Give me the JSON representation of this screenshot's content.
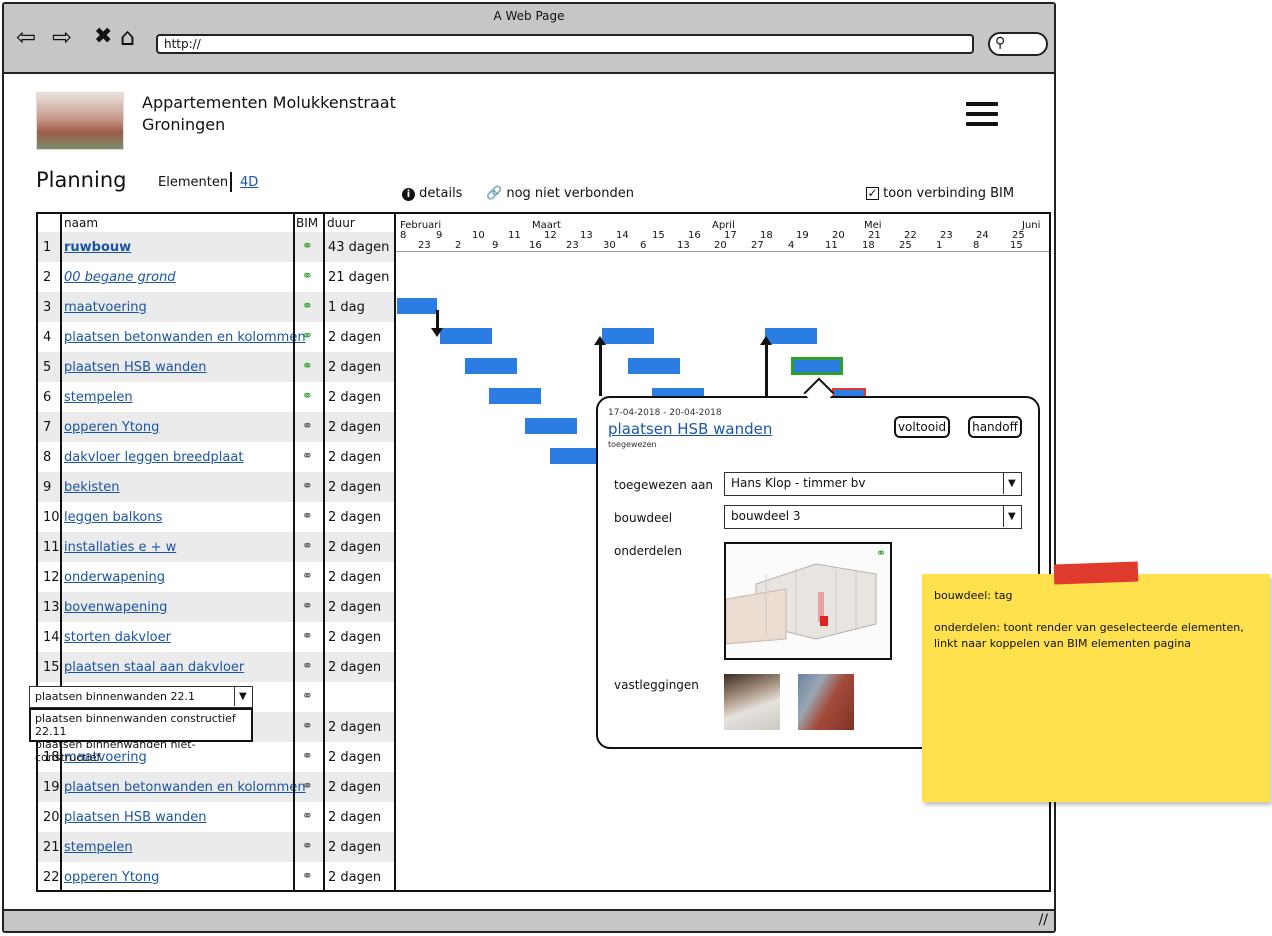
{
  "window": {
    "title": "A Web Page",
    "url": "http://"
  },
  "project": {
    "name_line1": "Appartementen Molukkenstraat",
    "name_line2": "Groningen"
  },
  "page": {
    "title": "Planning",
    "tab_elements": "Elementen",
    "tab_4d": "4D"
  },
  "toolbar": {
    "details": "details",
    "not_linked": "nog niet verbonden",
    "show_bim": "toon verbinding BIM",
    "show_bim_checked": true
  },
  "table": {
    "headers": {
      "name": "naam",
      "bim": "BIM",
      "duration": "duur"
    },
    "rows": [
      {
        "n": "1",
        "name": "ruwbouw",
        "dur": "43 dagen",
        "linked": true,
        "style": "bold"
      },
      {
        "n": "2",
        "name": "00 begane grond",
        "dur": "21 dagen",
        "linked": true,
        "style": "italic"
      },
      {
        "n": "3",
        "name": "maatvoering",
        "dur": "1 dag",
        "linked": true
      },
      {
        "n": "4",
        "name": "plaatsen betonwanden en kolommen",
        "dur": "2 dagen",
        "linked": true
      },
      {
        "n": "5",
        "name": "plaatsen HSB wanden",
        "dur": "2 dagen",
        "linked": true
      },
      {
        "n": "6",
        "name": "stempelen",
        "dur": "2 dagen",
        "linked": true
      },
      {
        "n": "7",
        "name": "opperen Ytong",
        "dur": "2 dagen",
        "linked": false
      },
      {
        "n": "8",
        "name": "dakvloer leggen breedplaat",
        "dur": "2 dagen",
        "linked": false
      },
      {
        "n": "9",
        "name": "bekisten",
        "dur": "2 dagen",
        "linked": false
      },
      {
        "n": "10",
        "name": "leggen balkons",
        "dur": "2 dagen",
        "linked": false
      },
      {
        "n": "11",
        "name": "installaties e + w",
        "dur": "2 dagen",
        "linked": false
      },
      {
        "n": "12",
        "name": "onderwapening",
        "dur": "2 dagen",
        "linked": false
      },
      {
        "n": "13",
        "name": "bovenwapening",
        "dur": "2 dagen",
        "linked": false
      },
      {
        "n": "14",
        "name": "storten dakvloer",
        "dur": "2 dagen",
        "linked": false
      },
      {
        "n": "15",
        "name": "plaatsen staal aan dakvloer",
        "dur": "2 dagen",
        "linked": false
      },
      {
        "n": "16",
        "name": "",
        "dur": "",
        "linked": false
      },
      {
        "n": "17",
        "name": "",
        "dur": "2 dagen",
        "linked": false
      },
      {
        "n": "18",
        "name": "maatvoering",
        "dur": "2 dagen",
        "linked": false
      },
      {
        "n": "19",
        "name": "plaatsen betonwanden en kolommen",
        "dur": "2 dagen",
        "linked": false
      },
      {
        "n": "20",
        "name": "plaatsen HSB wanden",
        "dur": "2 dagen",
        "linked": false
      },
      {
        "n": "21",
        "name": "stempelen",
        "dur": "2 dagen",
        "linked": false
      },
      {
        "n": "22",
        "name": "opperen Ytong",
        "dur": "2 dagen",
        "linked": false
      }
    ],
    "row16_select": {
      "value": "plaatsen binnenwanden 22.1",
      "options": [
        "plaatsen binnenwanden constructief 22.11",
        "plaatsen binnenwanden niet-constructief"
      ]
    }
  },
  "gantt": {
    "months": [
      "Februari",
      "Maart",
      "April",
      "Mei",
      "Juni"
    ],
    "weeks": [
      "8",
      "9",
      "10",
      "11",
      "12",
      "13",
      "14",
      "15",
      "16",
      "17",
      "18",
      "19",
      "20",
      "21",
      "22",
      "23",
      "24",
      "25"
    ],
    "days": [
      "23",
      "2",
      "9",
      "16",
      "23",
      "30",
      "6",
      "13",
      "20",
      "27",
      "4",
      "11",
      "18",
      "25",
      "1",
      "8",
      "15"
    ]
  },
  "popup": {
    "dates": "17-04-2018 - 20-04-2018",
    "title": "plaatsen HSB wanden",
    "status": "toegewezen",
    "btn_done": "voltooid",
    "btn_handoff": "handoff",
    "assigned_label": "toegewezen aan",
    "assigned_value": "Hans Klop - timmer bv",
    "part_label": "bouwdeel",
    "part_value": "bouwdeel 3",
    "components_label": "onderdelen",
    "records_label": "vastleggingen"
  },
  "note": {
    "line1": "bouwdeel: tag",
    "line2": "onderdelen: toont render van geselecteerde elementen, linkt naar koppelen van BIM elementen pagina"
  },
  "colors": {
    "bar": "#2b7de4",
    "link": "#1a55a7",
    "linked_icon": "#2ea02e",
    "note": "#ffe04d",
    "tape": "#e03a2f"
  }
}
